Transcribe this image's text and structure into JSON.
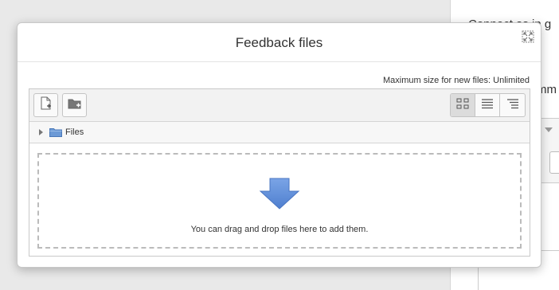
{
  "background": {
    "text_top": "Connect as in g",
    "text_mid": "mm"
  },
  "dialog": {
    "title": "Feedback files",
    "max_size_label": "Maximum size for new files: Unlimited"
  },
  "file_manager": {
    "path_root": "Files",
    "drop_message": "You can drag and drop files here to add them."
  },
  "colors": {
    "drop_arrow": "#5b8bd9",
    "folder": "#6c9ad6"
  },
  "icons": {
    "add_file": "add-file-icon",
    "create_folder": "create-folder-icon",
    "view_icons": "grid-view-icon",
    "view_details": "list-view-icon",
    "view_tree": "tree-view-icon",
    "maximize": "maximize-icon"
  }
}
